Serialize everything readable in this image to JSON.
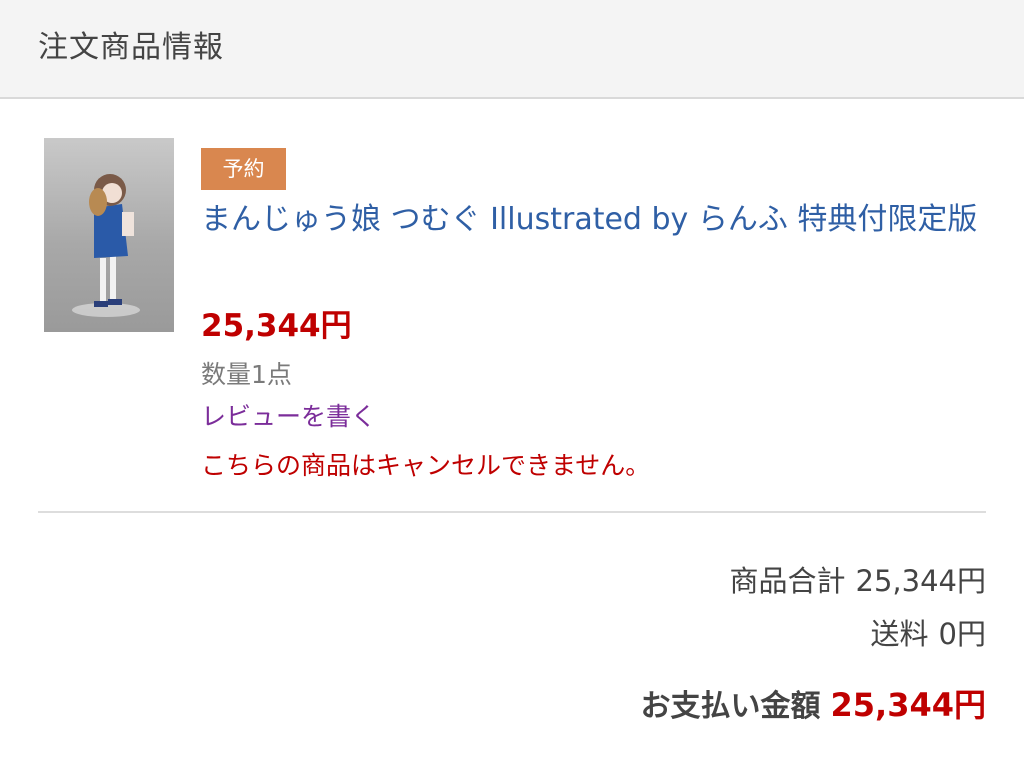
{
  "section": {
    "title": "注文商品情報"
  },
  "item": {
    "badge": "予約",
    "name": "まんじゅう娘 つむぐ Illustrated by らんふ 特典付限定版",
    "price": "25,344円",
    "quantity": "数量1点",
    "review_link": "レビューを書く",
    "cancel_note": "こちらの商品はキャンセルできません。",
    "image_icon": "figure-thumbnail"
  },
  "summary": {
    "subtotal_label": "商品合計",
    "subtotal_value": "25,344円",
    "shipping_label": "送料",
    "shipping_value": "0円",
    "total_label": "お支払い金額",
    "total_value": "25,344円"
  },
  "colors": {
    "link_blue": "#2f5fa5",
    "price_red": "#bf0000",
    "badge_orange": "#d9874f",
    "review_purple": "#7b2d9a"
  }
}
